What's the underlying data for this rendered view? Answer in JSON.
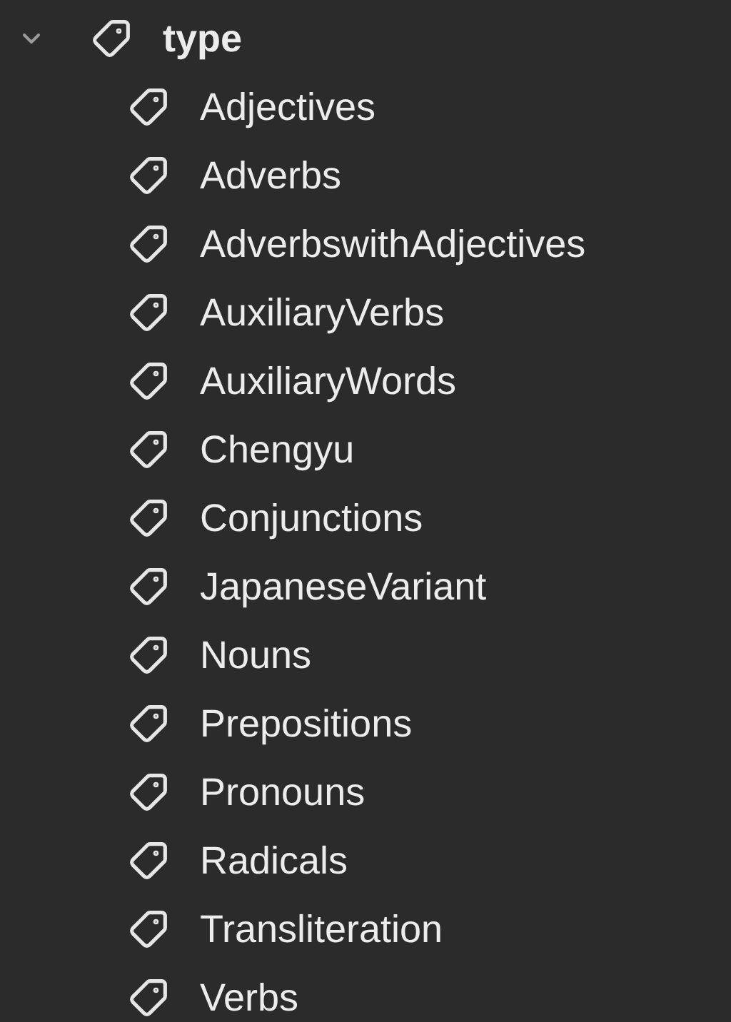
{
  "tree": [
    {
      "label": "type",
      "expanded": true,
      "children": [
        {
          "label": "Adjectives"
        },
        {
          "label": "Adverbs"
        },
        {
          "label": "AdverbswithAdjectives"
        },
        {
          "label": "AuxiliaryVerbs"
        },
        {
          "label": "AuxiliaryWords"
        },
        {
          "label": "Chengyu"
        },
        {
          "label": "Conjunctions"
        },
        {
          "label": "JapaneseVariant"
        },
        {
          "label": "Nouns"
        },
        {
          "label": "Prepositions"
        },
        {
          "label": "Pronouns"
        },
        {
          "label": "Radicals"
        },
        {
          "label": "Transliteration"
        },
        {
          "label": "Verbs"
        }
      ]
    }
  ]
}
